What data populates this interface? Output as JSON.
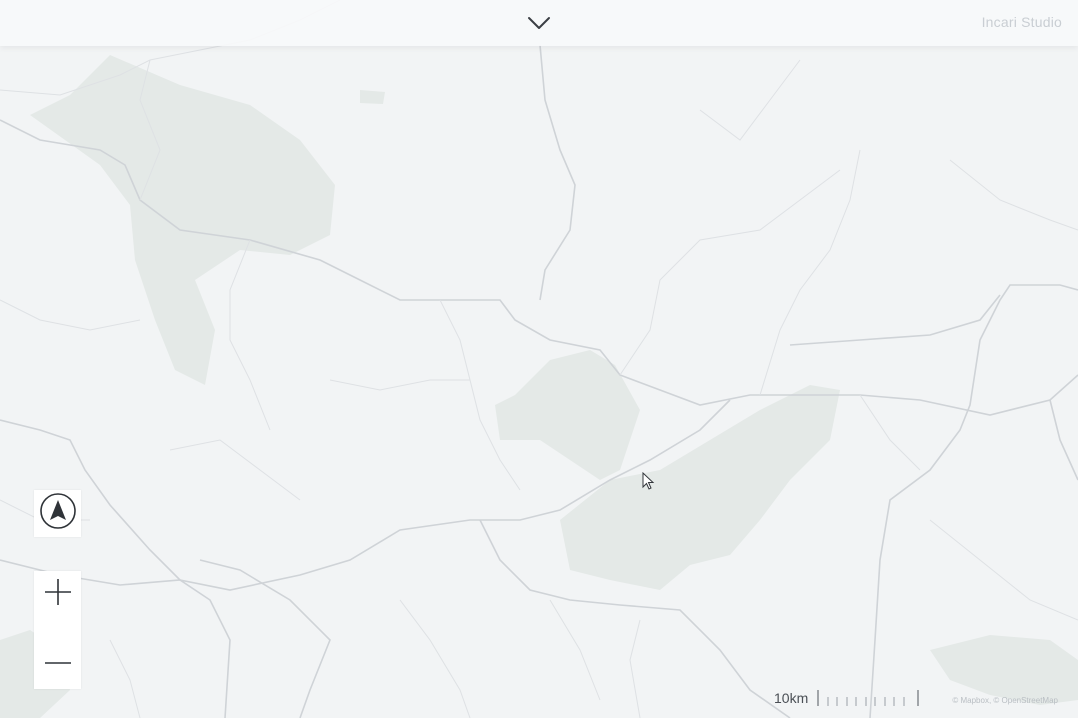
{
  "header": {
    "brand": "Incari Studio",
    "toggle_icon": "chevron-down-icon"
  },
  "controls": {
    "compass_icon": "navigation-arrow-icon",
    "zoom_in_icon": "plus-icon",
    "zoom_out_icon": "minus-icon"
  },
  "scale": {
    "label": "10km"
  },
  "attribution": "© Mapbox, © OpenStreetMap",
  "colors": {
    "land": "#f2f4f5",
    "forest": "#e4e9e7",
    "road": "#cfd3d7",
    "text_brand": "#c9ced3"
  }
}
